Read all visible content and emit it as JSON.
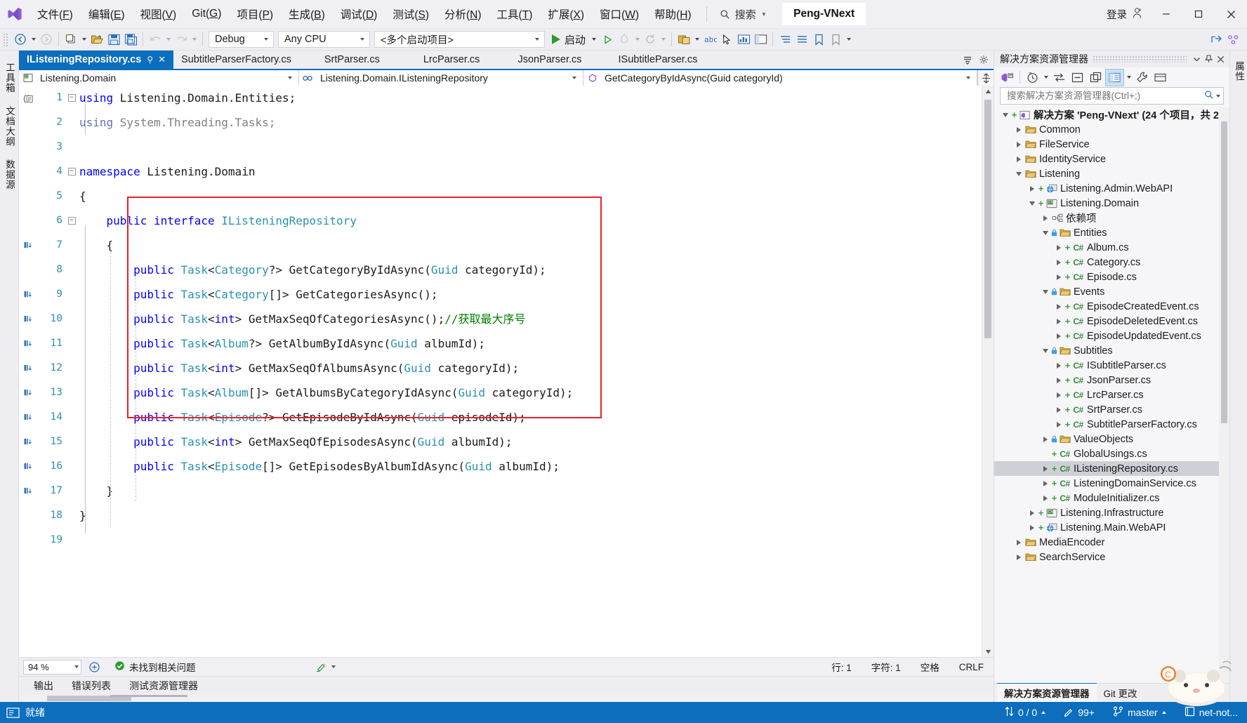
{
  "window": {
    "solution_name": "Peng-VNext",
    "signin_label": "登录",
    "minimize": "minimize-icon",
    "maximize": "maximize-icon",
    "close": "close-icon"
  },
  "menu": {
    "items": [
      {
        "label": "文件(F)",
        "pre": "文件(",
        "key": "F",
        "post": ")"
      },
      {
        "label": "编辑(E)",
        "pre": "编辑(",
        "key": "E",
        "post": ")"
      },
      {
        "label": "视图(V)",
        "pre": "视图(",
        "key": "V",
        "post": ")"
      },
      {
        "label": "Git(G)",
        "pre": "Git(",
        "key": "G",
        "post": ")"
      },
      {
        "label": "项目(P)",
        "pre": "项目(",
        "key": "P",
        "post": ")"
      },
      {
        "label": "生成(B)",
        "pre": "生成(",
        "key": "B",
        "post": ")"
      },
      {
        "label": "调试(D)",
        "pre": "调试(",
        "key": "D",
        "post": ")"
      },
      {
        "label": "测试(S)",
        "pre": "测试(",
        "key": "S",
        "post": ")"
      },
      {
        "label": "分析(N)",
        "pre": "分析(",
        "key": "N",
        "post": ")"
      },
      {
        "label": "工具(T)",
        "pre": "工具(",
        "key": "T",
        "post": ")"
      },
      {
        "label": "扩展(X)",
        "pre": "扩展(",
        "key": "X",
        "post": ")"
      },
      {
        "label": "窗口(W)",
        "pre": "窗口(",
        "key": "W",
        "post": ")"
      },
      {
        "label": "帮助(H)",
        "pre": "帮助(",
        "key": "H",
        "post": ")"
      }
    ],
    "search_label": "搜索"
  },
  "toolbar": {
    "nav_back": "back-icon",
    "nav_forward": "forward-icon",
    "new_project": "new-project-icon",
    "open_file": "open-file-icon",
    "save": "save-icon",
    "save_all": "save-all-icon",
    "undo": "undo-icon",
    "redo": "redo-icon",
    "configuration": "Debug",
    "platform": "Any CPU",
    "startup_project": "<多个启动项目>",
    "start_label": "启动"
  },
  "editor": {
    "tabs": [
      {
        "label": "IListeningRepository.cs",
        "active": true,
        "pinned": true,
        "closable": true
      },
      {
        "label": "SubtitleParserFactory.cs",
        "active": false
      },
      {
        "label": "SrtParser.cs",
        "active": false
      },
      {
        "label": "LrcParser.cs",
        "active": false
      },
      {
        "label": "JsonParser.cs",
        "active": false
      },
      {
        "label": "ISubtitleParser.cs",
        "active": false
      }
    ],
    "navbar": {
      "project": "Listening.Domain",
      "type": "Listening.Domain.IListeningRepository",
      "member": "GetCategoryByIdAsync(Guid categoryId)"
    },
    "lines": [
      {
        "n": 1,
        "glyph": true,
        "fold": "minus",
        "tokens": [
          {
            "t": "k",
            "v": "using "
          },
          {
            "t": "p",
            "v": "Listening.Domain.Entities;"
          }
        ]
      },
      {
        "n": 2,
        "glyph": false,
        "fold": "",
        "tokens": [
          {
            "t": "gb",
            "v": "using "
          },
          {
            "t": "g",
            "v": "System.Threading.Tasks;"
          }
        ]
      },
      {
        "n": 3,
        "glyph": false,
        "fold": "",
        "tokens": []
      },
      {
        "n": 4,
        "glyph": false,
        "fold": "minus",
        "tokens": [
          {
            "t": "k",
            "v": "namespace "
          },
          {
            "t": "p",
            "v": "Listening.Domain"
          }
        ]
      },
      {
        "n": 5,
        "glyph": false,
        "fold": "",
        "tokens": [
          {
            "t": "p",
            "v": "{"
          }
        ]
      },
      {
        "n": 6,
        "glyph": true,
        "fold": "minus",
        "tokens": [
          {
            "t": "p",
            "v": "    "
          },
          {
            "t": "k",
            "v": "public interface "
          },
          {
            "t": "t",
            "v": "IListeningRepository"
          }
        ]
      },
      {
        "n": 7,
        "glyph": false,
        "fold": "",
        "tokens": [
          {
            "t": "p",
            "v": "    {"
          }
        ]
      },
      {
        "n": 8,
        "glyph": true,
        "fold": "",
        "tokens": [
          {
            "t": "p",
            "v": "        "
          },
          {
            "t": "k",
            "v": "public "
          },
          {
            "t": "t",
            "v": "Task"
          },
          {
            "t": "p",
            "v": "<"
          },
          {
            "t": "t",
            "v": "Category"
          },
          {
            "t": "p",
            "v": "?> GetCategoryByIdAsync("
          },
          {
            "t": "t",
            "v": "Guid"
          },
          {
            "t": "p",
            "v": " categoryId);"
          }
        ]
      },
      {
        "n": 9,
        "glyph": true,
        "fold": "",
        "tokens": [
          {
            "t": "p",
            "v": "        "
          },
          {
            "t": "k",
            "v": "public "
          },
          {
            "t": "t",
            "v": "Task"
          },
          {
            "t": "p",
            "v": "<"
          },
          {
            "t": "t",
            "v": "Category"
          },
          {
            "t": "p",
            "v": "[]> GetCategoriesAsync();"
          }
        ]
      },
      {
        "n": 10,
        "glyph": true,
        "fold": "",
        "tokens": [
          {
            "t": "p",
            "v": "        "
          },
          {
            "t": "k",
            "v": "public "
          },
          {
            "t": "t",
            "v": "Task"
          },
          {
            "t": "p",
            "v": "<"
          },
          {
            "t": "k",
            "v": "int"
          },
          {
            "t": "p",
            "v": "> GetMaxSeqOfCategoriesAsync();"
          },
          {
            "t": "c",
            "v": "//获取最大序号"
          }
        ]
      },
      {
        "n": 11,
        "glyph": true,
        "fold": "",
        "tokens": [
          {
            "t": "p",
            "v": "        "
          },
          {
            "t": "k",
            "v": "public "
          },
          {
            "t": "t",
            "v": "Task"
          },
          {
            "t": "p",
            "v": "<"
          },
          {
            "t": "t",
            "v": "Album"
          },
          {
            "t": "p",
            "v": "?> GetAlbumByIdAsync("
          },
          {
            "t": "t",
            "v": "Guid"
          },
          {
            "t": "p",
            "v": " albumId);"
          }
        ]
      },
      {
        "n": 12,
        "glyph": true,
        "fold": "",
        "tokens": [
          {
            "t": "p",
            "v": "        "
          },
          {
            "t": "k",
            "v": "public "
          },
          {
            "t": "t",
            "v": "Task"
          },
          {
            "t": "p",
            "v": "<"
          },
          {
            "t": "k",
            "v": "int"
          },
          {
            "t": "p",
            "v": "> GetMaxSeqOfAlbumsAsync("
          },
          {
            "t": "t",
            "v": "Guid"
          },
          {
            "t": "p",
            "v": " categoryId);"
          }
        ]
      },
      {
        "n": 13,
        "glyph": true,
        "fold": "",
        "tokens": [
          {
            "t": "p",
            "v": "        "
          },
          {
            "t": "k",
            "v": "public "
          },
          {
            "t": "t",
            "v": "Task"
          },
          {
            "t": "p",
            "v": "<"
          },
          {
            "t": "t",
            "v": "Album"
          },
          {
            "t": "p",
            "v": "[]> GetAlbumsByCategoryIdAsync("
          },
          {
            "t": "t",
            "v": "Guid"
          },
          {
            "t": "p",
            "v": " categoryId);"
          }
        ]
      },
      {
        "n": 14,
        "glyph": true,
        "fold": "",
        "tokens": [
          {
            "t": "p",
            "v": "        "
          },
          {
            "t": "k",
            "v": "public "
          },
          {
            "t": "t",
            "v": "Task"
          },
          {
            "t": "p",
            "v": "<"
          },
          {
            "t": "t",
            "v": "Episode"
          },
          {
            "t": "p",
            "v": "?> GetEpisodeByIdAsync("
          },
          {
            "t": "t",
            "v": "Guid"
          },
          {
            "t": "p",
            "v": " episodeId);"
          }
        ]
      },
      {
        "n": 15,
        "glyph": true,
        "fold": "",
        "tokens": [
          {
            "t": "p",
            "v": "        "
          },
          {
            "t": "k",
            "v": "public "
          },
          {
            "t": "t",
            "v": "Task"
          },
          {
            "t": "p",
            "v": "<"
          },
          {
            "t": "k",
            "v": "int"
          },
          {
            "t": "p",
            "v": "> GetMaxSeqOfEpisodesAsync("
          },
          {
            "t": "t",
            "v": "Guid"
          },
          {
            "t": "p",
            "v": " albumId);"
          }
        ]
      },
      {
        "n": 16,
        "glyph": true,
        "fold": "",
        "tokens": [
          {
            "t": "p",
            "v": "        "
          },
          {
            "t": "k",
            "v": "public "
          },
          {
            "t": "t",
            "v": "Task"
          },
          {
            "t": "p",
            "v": "<"
          },
          {
            "t": "t",
            "v": "Episode"
          },
          {
            "t": "p",
            "v": "[]> GetEpisodesByAlbumIdAsync("
          },
          {
            "t": "t",
            "v": "Guid"
          },
          {
            "t": "p",
            "v": " albumId);"
          }
        ]
      },
      {
        "n": 17,
        "glyph": false,
        "fold": "",
        "tokens": [
          {
            "t": "p",
            "v": "    }"
          }
        ]
      },
      {
        "n": 18,
        "glyph": false,
        "fold": "",
        "tokens": [
          {
            "t": "p",
            "v": "}"
          }
        ]
      },
      {
        "n": 19,
        "glyph": false,
        "fold": "",
        "tokens": []
      }
    ],
    "annotation": {
      "color": "#e8202a",
      "shape": "rectangle"
    },
    "status": {
      "zoom": "94 %",
      "issues": "未找到相关问题",
      "line_label": "行: 1",
      "col_label": "字符: 1",
      "spaces": "空格",
      "eol": "CRLF"
    },
    "doc_tabs": [
      "输出",
      "错误列表",
      "测试资源管理器"
    ]
  },
  "left_strips": [
    {
      "label": "工具箱"
    },
    {
      "label": "文档大纲"
    },
    {
      "label": "数据源"
    }
  ],
  "solution_explorer": {
    "title": "解决方案资源管理器",
    "search_placeholder": "搜索解决方案资源管理器(Ctrl+;)",
    "bottom_tabs": [
      {
        "label": "解决方案资源管理器",
        "active": true
      },
      {
        "label": "Git 更改",
        "active": false
      }
    ],
    "tree": [
      {
        "depth": 0,
        "label": "解决方案 'Peng-VNext' (24 个项目，共 2",
        "icon": "solution-icon",
        "state": "expanded-plus",
        "bold": true,
        "plus": true
      },
      {
        "depth": 1,
        "label": "Common",
        "icon": "folder-icon",
        "state": "collapsed"
      },
      {
        "depth": 1,
        "label": "FileService",
        "icon": "folder-icon",
        "state": "collapsed"
      },
      {
        "depth": 1,
        "label": "IdentityService",
        "icon": "folder-icon",
        "state": "collapsed"
      },
      {
        "depth": 1,
        "label": "Listening",
        "icon": "folder-icon",
        "state": "expanded"
      },
      {
        "depth": 2,
        "label": "Listening.Admin.WebAPI",
        "icon": "webapi-icon",
        "state": "collapsed",
        "plus": true
      },
      {
        "depth": 2,
        "label": "Listening.Domain",
        "icon": "csproj-icon",
        "state": "expanded",
        "plus": true
      },
      {
        "depth": 3,
        "label": "依赖项",
        "icon": "dependencies-icon",
        "state": "collapsed"
      },
      {
        "depth": 3,
        "label": "Entities",
        "icon": "folder-icon",
        "state": "expanded",
        "lock": true
      },
      {
        "depth": 4,
        "label": "Album.cs",
        "icon": "csfile-icon",
        "state": "collapsed",
        "plus": true
      },
      {
        "depth": 4,
        "label": "Category.cs",
        "icon": "csfile-icon",
        "state": "collapsed",
        "plus": true
      },
      {
        "depth": 4,
        "label": "Episode.cs",
        "icon": "csfile-icon",
        "state": "collapsed",
        "plus": true
      },
      {
        "depth": 3,
        "label": "Events",
        "icon": "folder-icon",
        "state": "expanded",
        "lock": true
      },
      {
        "depth": 4,
        "label": "EpisodeCreatedEvent.cs",
        "icon": "csfile-icon",
        "state": "collapsed",
        "plus": true
      },
      {
        "depth": 4,
        "label": "EpisodeDeletedEvent.cs",
        "icon": "csfile-icon",
        "state": "collapsed",
        "plus": true
      },
      {
        "depth": 4,
        "label": "EpisodeUpdatedEvent.cs",
        "icon": "csfile-icon",
        "state": "collapsed",
        "plus": true
      },
      {
        "depth": 3,
        "label": "Subtitles",
        "icon": "folder-icon",
        "state": "expanded",
        "lock": true
      },
      {
        "depth": 4,
        "label": "ISubtitleParser.cs",
        "icon": "csfile-icon",
        "state": "collapsed",
        "plus": true
      },
      {
        "depth": 4,
        "label": "JsonParser.cs",
        "icon": "csfile-icon",
        "state": "collapsed",
        "plus": true
      },
      {
        "depth": 4,
        "label": "LrcParser.cs",
        "icon": "csfile-icon",
        "state": "collapsed",
        "plus": true
      },
      {
        "depth": 4,
        "label": "SrtParser.cs",
        "icon": "csfile-icon",
        "state": "collapsed",
        "plus": true
      },
      {
        "depth": 4,
        "label": "SubtitleParserFactory.cs",
        "icon": "csfile-icon",
        "state": "collapsed",
        "plus": true
      },
      {
        "depth": 3,
        "label": "ValueObjects",
        "icon": "folder-icon",
        "state": "collapsed",
        "lock": true
      },
      {
        "depth": 3,
        "label": "GlobalUsings.cs",
        "icon": "csfile-icon",
        "state": "none",
        "plus": true
      },
      {
        "depth": 3,
        "label": "IListeningRepository.cs",
        "icon": "csfile-icon",
        "state": "collapsed",
        "plus": true,
        "selected": true
      },
      {
        "depth": 3,
        "label": "ListeningDomainService.cs",
        "icon": "csfile-icon",
        "state": "collapsed",
        "plus": true
      },
      {
        "depth": 3,
        "label": "ModuleInitializer.cs",
        "icon": "csfile-icon",
        "state": "collapsed",
        "plus": true
      },
      {
        "depth": 2,
        "label": "Listening.Infrastructure",
        "icon": "csproj-icon",
        "state": "collapsed",
        "plus": true
      },
      {
        "depth": 2,
        "label": "Listening.Main.WebAPI",
        "icon": "webapi-icon",
        "state": "collapsed",
        "plus": true
      },
      {
        "depth": 1,
        "label": "MediaEncoder",
        "icon": "folder-icon",
        "state": "collapsed"
      },
      {
        "depth": 1,
        "label": "SearchService",
        "icon": "folder-icon",
        "state": "collapsed"
      }
    ]
  },
  "statusbar": {
    "ready": "就绪",
    "changes": "0 / 0",
    "errors": "99+",
    "branch": "master",
    "repo": "net-not..."
  },
  "colors": {
    "accent": "#0c6ebd",
    "annotation": "#e8202a",
    "keyword": "#0000ff",
    "type": "#2b91af",
    "comment": "#008000",
    "linenum": "#2b91af"
  }
}
